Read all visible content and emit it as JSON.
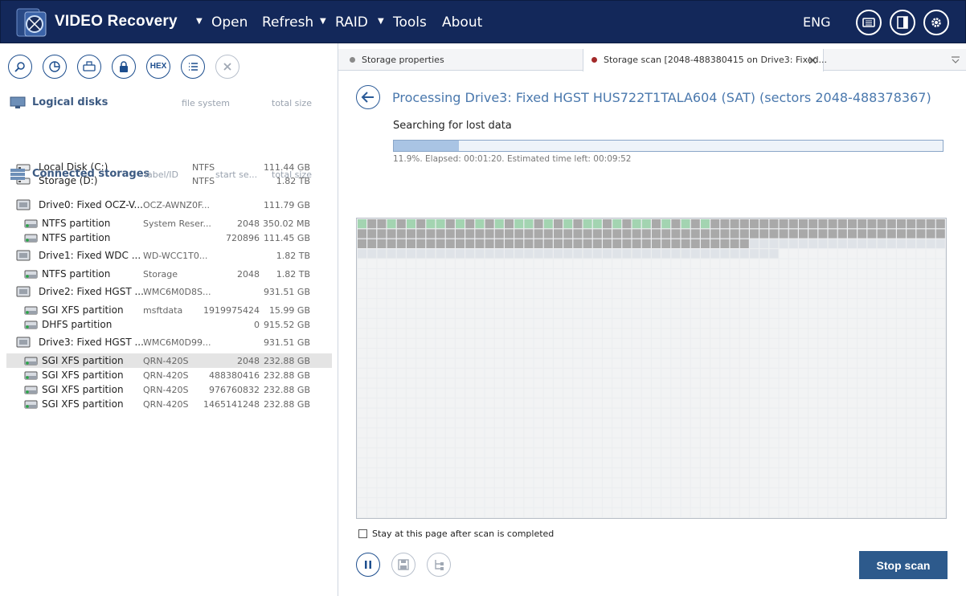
{
  "app": {
    "title": "VIDEO Recovery",
    "menu": [
      {
        "label": "Open",
        "has_arrow": true
      },
      {
        "label": "Refresh",
        "has_arrow": false
      },
      {
        "label": "RAID",
        "has_arrow": true
      },
      {
        "label": "Tools",
        "has_arrow": true
      },
      {
        "label": "About",
        "has_arrow": false
      }
    ],
    "language": "ENG",
    "header_icons": [
      "keyboard-icon",
      "panel-icon",
      "settings-icon"
    ]
  },
  "toolbar": {
    "buttons": [
      "search-icon",
      "chart-icon",
      "drive-icon",
      "lock-icon",
      "HEX",
      "list-icon",
      "close-icon"
    ],
    "hex_label": "HEX"
  },
  "logical_disks": {
    "title": "Logical disks",
    "col_fs": "file system",
    "col_size": "total size",
    "items": [
      {
        "name": "Local Disk (C:)",
        "fs": "NTFS",
        "size": "111.44 GB"
      },
      {
        "name": "Storage (D:)",
        "fs": "NTFS",
        "size": "1.82 TB"
      }
    ]
  },
  "connected_storages": {
    "title": "Connected storages",
    "col_label": "label/ID",
    "col_start": "start se...",
    "col_size": "total size",
    "items": [
      {
        "type": "drive",
        "name": "Drive0: Fixed OCZ-V...",
        "label": "OCZ-AWNZ0F...",
        "start": "",
        "size": "111.79 GB"
      },
      {
        "type": "part",
        "name": "NTFS partition",
        "label": "System Reser...",
        "start": "2048",
        "size": "350.02 MB"
      },
      {
        "type": "part",
        "name": "NTFS partition",
        "label": "",
        "start": "720896",
        "size": "111.45 GB"
      },
      {
        "type": "drive",
        "name": "Drive1: Fixed WDC ...",
        "label": "WD-WCC1T0...",
        "start": "",
        "size": "1.82 TB"
      },
      {
        "type": "part",
        "name": "NTFS partition",
        "label": "Storage",
        "start": "2048",
        "size": "1.82 TB"
      },
      {
        "type": "drive",
        "name": "Drive2: Fixed HGST ...",
        "label": "WMC6M0D8S...",
        "start": "",
        "size": "931.51 GB"
      },
      {
        "type": "part",
        "name": "SGI XFS partition",
        "label": "msftdata",
        "start": "1919975424",
        "size": "15.99 GB"
      },
      {
        "type": "part",
        "name": "DHFS partition",
        "label": "",
        "start": "0",
        "size": "915.52 GB"
      },
      {
        "type": "drive",
        "name": "Drive3: Fixed HGST ...",
        "label": "WMC6M0D99...",
        "start": "",
        "size": "931.51 GB"
      },
      {
        "type": "part",
        "name": "SGI XFS partition",
        "label": "QRN-420S",
        "start": "2048",
        "size": "232.88 GB",
        "selected": true
      },
      {
        "type": "part",
        "name": "SGI XFS partition",
        "label": "QRN-420S",
        "start": "488380416",
        "size": "232.88 GB"
      },
      {
        "type": "part",
        "name": "SGI XFS partition",
        "label": "QRN-420S",
        "start": "976760832",
        "size": "232.88 GB"
      },
      {
        "type": "part",
        "name": "SGI XFS partition",
        "label": "QRN-420S",
        "start": "1465141248",
        "size": "232.88 GB"
      }
    ]
  },
  "tabs": [
    {
      "label": "Storage properties",
      "active": false,
      "dot_color": "#8a8a8a"
    },
    {
      "label": "Storage scan [2048-488380415 on Drive3: Fixed...",
      "active": true,
      "dot_color": "#a32a2a"
    }
  ],
  "scan": {
    "title": "Processing Drive3: Fixed HGST HUS722T1TALA604 (SAT) (sectors 2048-488378367)",
    "status": "Searching for lost data",
    "progress": 0.119,
    "progress_text": "11.9%. Elapsed: 00:01:20. Estimated time left: 00:09:52",
    "stay_label": "Stay at this page after scan is completed",
    "stop_label": "Stop scan",
    "map_colors": {
      "found": "#a3d4b1",
      "scanned": "#a9a9a9",
      "partial": "#dfe3e8",
      "empty": "#f2f3f4"
    }
  }
}
